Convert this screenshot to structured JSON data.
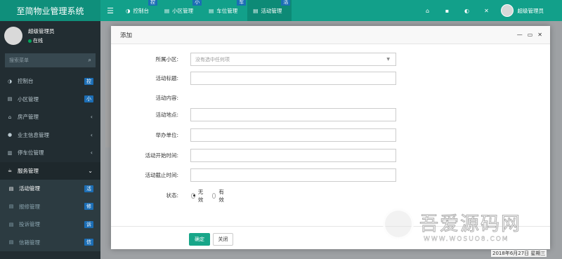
{
  "app": {
    "title": "至简物业管理系统"
  },
  "topbar": {
    "tabs": [
      {
        "label": "控制台",
        "tag": "控",
        "icon": "dashboard-icon"
      },
      {
        "label": "小区管理",
        "tag": "小",
        "icon": "list-icon"
      },
      {
        "label": "车位管理",
        "tag": "车",
        "icon": "list-icon"
      },
      {
        "label": "活动管理",
        "tag": "活",
        "icon": "list-icon",
        "active": true
      }
    ],
    "user": "超级管理员"
  },
  "sidebar": {
    "user_name": "超级管理员",
    "status": "在线",
    "search_placeholder": "搜索菜单",
    "items": [
      {
        "label": "控制台",
        "badge": "控",
        "icon": "dashboard-icon"
      },
      {
        "label": "小区管理",
        "badge": "小",
        "icon": "list-icon"
      },
      {
        "label": "房产管理",
        "icon": "home-icon"
      },
      {
        "label": "业主信息管理",
        "icon": "user-icon"
      },
      {
        "label": "停车位管理",
        "icon": "parking-icon"
      },
      {
        "label": "服务管理",
        "icon": "service-icon"
      },
      {
        "label": "活动管理",
        "badge": "活",
        "icon": "list-icon"
      },
      {
        "label": "报修管理",
        "badge": "修",
        "icon": "list-icon"
      },
      {
        "label": "投诉管理",
        "badge": "诉",
        "icon": "list-icon"
      },
      {
        "label": "信箱管理",
        "badge": "信",
        "icon": "list-icon"
      }
    ]
  },
  "modal": {
    "title": "添加",
    "fields": {
      "community_label": "所属小区:",
      "community_placeholder": "没有选中任何项",
      "title_label": "活动标题:",
      "content_label": "活动内容:",
      "place_label": "活动地点:",
      "organizer_label": "举办单位:",
      "start_label": "活动开始时间:",
      "end_label": "活动截止时间:",
      "status_label": "状态:",
      "status_options": [
        "无效",
        "有效"
      ],
      "status_selected": "无效"
    },
    "buttons": {
      "ok": "确定",
      "close": "关闭"
    }
  },
  "watermark": {
    "text": "吾爱源码网",
    "sub": "WWW.WOSUO8.COM"
  },
  "datetime": "2018年6月27日 星期三",
  "colors": {
    "accent": "#12a08a",
    "sidebar": "#222d32",
    "badge": "#1c6eb5",
    "ok_button": "#18a689"
  }
}
